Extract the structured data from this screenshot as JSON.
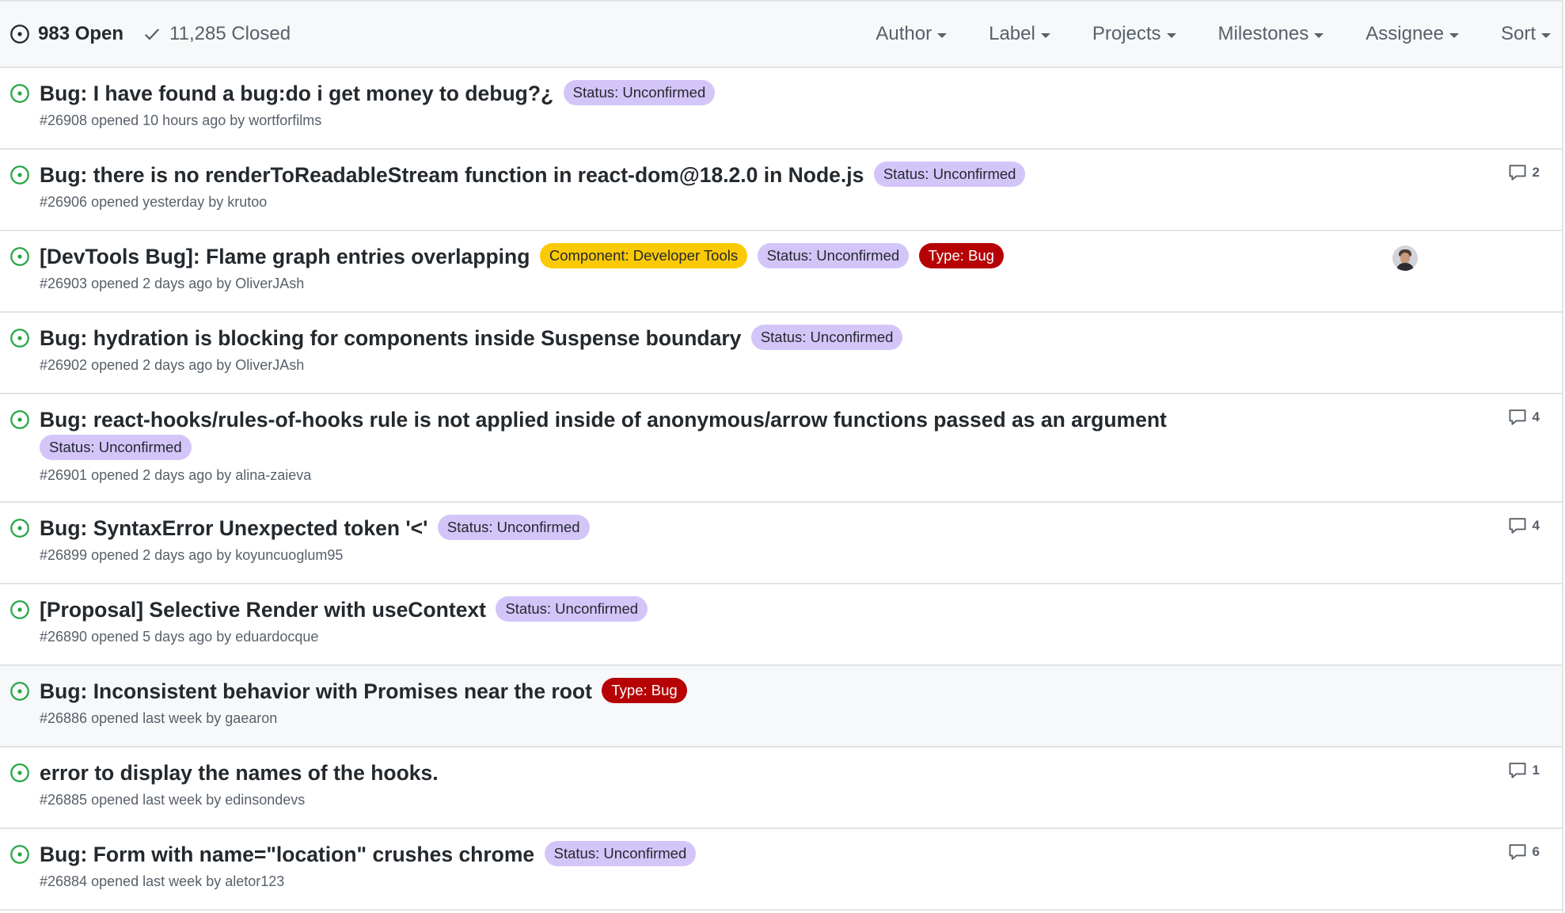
{
  "header": {
    "open_label": "983 Open",
    "closed_label": "11,285 Closed",
    "filters": [
      "Author",
      "Label",
      "Projects",
      "Milestones",
      "Assignee",
      "Sort"
    ]
  },
  "colors": {
    "open_green": "#28a745",
    "label_unconfirmed_bg": "#d4c5f9",
    "label_devtools_bg": "#fbca04",
    "label_bug_bg": "#b60205"
  },
  "issues": [
    {
      "title": "Bug: I have found a bug:do i get money to debug?¿",
      "labels": [
        "Status: Unconfirmed"
      ],
      "number": "#26908",
      "opened": "opened 10 hours ago by",
      "author": "wortforfilms"
    },
    {
      "title": "Bug: there is no renderToReadableStream function in react-dom@18.2.0 in Node.js",
      "labels": [
        "Status: Unconfirmed"
      ],
      "number": "#26906",
      "opened": "opened yesterday by",
      "author": "krutoo",
      "comments": "2"
    },
    {
      "title": "[DevTools Bug]: Flame graph entries overlapping",
      "labels": [
        "Component: Developer Tools",
        "Status: Unconfirmed",
        "Type: Bug"
      ],
      "number": "#26903",
      "opened": "opened 2 days ago by",
      "author": "OliverJAsh"
    },
    {
      "title": "Bug: hydration is blocking for components inside Suspense boundary",
      "labels": [
        "Status: Unconfirmed"
      ],
      "number": "#26902",
      "opened": "opened 2 days ago by",
      "author": "OliverJAsh"
    },
    {
      "title": "Bug: react-hooks/rules-of-hooks rule is not applied inside of anonymous/arrow functions passed as an argument",
      "labels": [
        "Status: Unconfirmed"
      ],
      "number": "#26901",
      "opened": "opened 2 days ago by",
      "author": "alina-zaieva",
      "comments": "4"
    },
    {
      "title": "Bug: SyntaxError Unexpected token '<'",
      "labels": [
        "Status: Unconfirmed"
      ],
      "number": "#26899",
      "opened": "opened 2 days ago by",
      "author": "koyuncuoglum95",
      "comments": "4"
    },
    {
      "title": "[Proposal] Selective Render with useContext",
      "labels": [
        "Status: Unconfirmed"
      ],
      "number": "#26890",
      "opened": "opened 5 days ago by",
      "author": "eduardocque"
    },
    {
      "title": "Bug: Inconsistent behavior with Promises near the root",
      "labels": [
        "Type: Bug"
      ],
      "number": "#26886",
      "opened": "opened last week by",
      "author": "gaearon"
    },
    {
      "title": "error to display the names of the hooks.",
      "labels": [],
      "number": "#26885",
      "opened": "opened last week by",
      "author": "edinsondevs",
      "comments": "1"
    },
    {
      "title": "Bug: Form with name=\"location\" crushes chrome",
      "labels": [
        "Status: Unconfirmed"
      ],
      "number": "#26884",
      "opened": "opened last week by",
      "author": "aletor123",
      "comments": "6"
    }
  ]
}
